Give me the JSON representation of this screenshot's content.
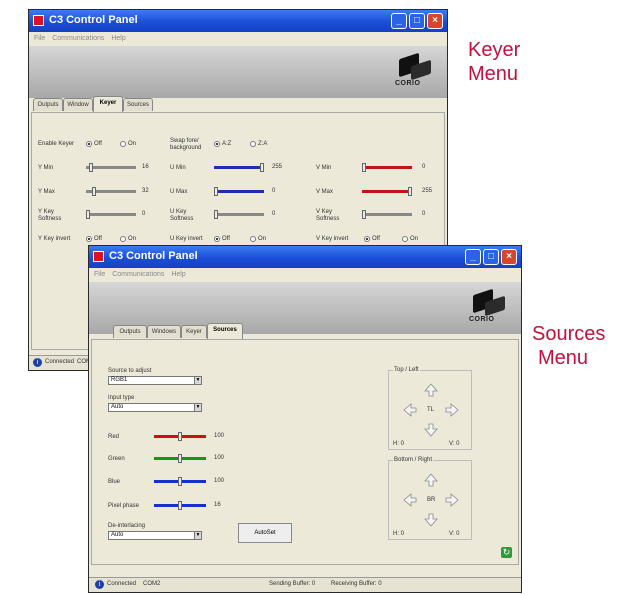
{
  "app_title": "C3 Control Panel",
  "menu": [
    "File",
    "Communications",
    "Help"
  ],
  "logo_text": "CORIO",
  "callouts": {
    "keyer": [
      "Keyer",
      "Menu"
    ],
    "sources": [
      "Sources",
      "Menu"
    ]
  },
  "keyer_window": {
    "tabs": [
      "Outputs",
      "Window",
      "Keyer",
      "Sources"
    ],
    "active_tab": "Keyer",
    "enable_keyer": {
      "label": "Enable Keyer",
      "options": [
        "Off",
        "On"
      ],
      "selected": "Off"
    },
    "swap": {
      "label_line1": "Swap fore/",
      "label_line2": "background",
      "options": [
        "A:Z",
        "Z:A"
      ],
      "selected": "A:Z"
    },
    "y_sliders": [
      {
        "label": "Y Min",
        "value": "16",
        "level": 0.06
      },
      {
        "label": "Y Max",
        "value": "32",
        "level": 0.13
      },
      {
        "label_line1": "Y Key",
        "label_line2": "Softness",
        "value": "0",
        "level": 0.0
      }
    ],
    "u_sliders": [
      {
        "label": "U Min",
        "value": "255",
        "level": 1.0
      },
      {
        "label": "U Max",
        "value": "0",
        "level": 0.0
      },
      {
        "label_line1": "U Key",
        "label_line2": "Softness",
        "value": "0",
        "level": 0.0
      }
    ],
    "v_sliders": [
      {
        "label": "V Min",
        "value": "0",
        "level": 0.0
      },
      {
        "label": "V Max",
        "value": "255",
        "level": 1.0
      },
      {
        "label_line1": "V Key",
        "label_line2": "Softness",
        "value": "0",
        "level": 0.0
      }
    ],
    "invert": [
      {
        "label": "Y Key invert",
        "options": [
          "Off",
          "On"
        ],
        "selected": "Off"
      },
      {
        "label": "U Key invert",
        "options": [
          "Off",
          "On"
        ],
        "selected": "Off"
      },
      {
        "label": "V Key invert",
        "options": [
          "Off",
          "On"
        ],
        "selected": "Off"
      }
    ],
    "status_connected": "Connected",
    "status_port": "COM2"
  },
  "sources_window": {
    "tabs": [
      "Outputs",
      "Windows",
      "Keyer",
      "Sources"
    ],
    "active_tab": "Sources",
    "source_to_adjust": {
      "label": "Source to adjust",
      "value": "RGB1"
    },
    "input_type": {
      "label": "Input type",
      "value": "Auto"
    },
    "sliders": [
      {
        "label": "Red",
        "value": "100",
        "level": 0.5,
        "color": "#cc1111"
      },
      {
        "label": "Green",
        "value": "100",
        "level": 0.5,
        "color": "#119911"
      },
      {
        "label": "Blue",
        "value": "100",
        "level": 0.5,
        "color": "#1133cc"
      },
      {
        "label": "Pixel phase",
        "value": "16",
        "level": 0.5,
        "color": "#1133cc"
      }
    ],
    "deinterlacing": {
      "label": "De-interlacing",
      "value": "Auto"
    },
    "autoset_label": "AutoSet",
    "top_left": {
      "title": "Top / Left",
      "center": "TL",
      "h": "H: 0",
      "v": "V: 0"
    },
    "bottom_right": {
      "title": "Bottom / Right",
      "center": "BR",
      "h": "H: 0",
      "v": "V: 0"
    },
    "status_connected": "Connected",
    "status_port": "COM2",
    "sending_buffer": "Sending Buffer: 0",
    "receiving_buffer": "Receiving Buffer: 0"
  },
  "colors": {
    "y_track": "#888888",
    "u_track": "#1b2fb0",
    "v_track": "#c41414",
    "callout": "#c0123c"
  }
}
